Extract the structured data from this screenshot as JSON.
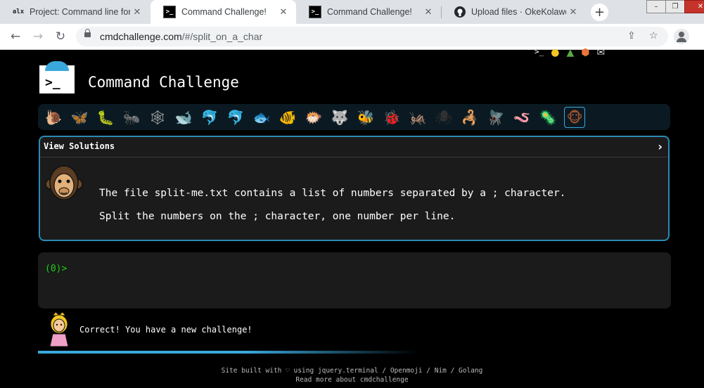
{
  "browser": {
    "tabs": [
      {
        "favicon": "alx",
        "title": "Project: Command line for",
        "active": false
      },
      {
        "favicon": "terminal-icon",
        "title": "Command Challenge!",
        "active": true
      },
      {
        "favicon": "terminal-icon",
        "title": "Command Challenge!",
        "active": false
      },
      {
        "favicon": "github-icon",
        "title": "Upload files · OkeKolawole",
        "active": false
      }
    ],
    "new_tab_label": "+",
    "url_host": "cmdchallenge.com",
    "url_path": "/#/split_on_a_char"
  },
  "page": {
    "title": "Command Challenge",
    "logo_glyph": ">_",
    "animals": [
      "snail",
      "butterfly",
      "caterpillar",
      "ant",
      "spider-web",
      "whale",
      "dolphin",
      "dolphin-gray",
      "fish",
      "tropical-fish",
      "blowfish",
      "wolf",
      "bee",
      "ladybug",
      "cricket",
      "spider",
      "scorpion",
      "fly",
      "worm",
      "microbe",
      "monkey"
    ],
    "panel": {
      "header": "View Solutions",
      "line1": "The file split-me.txt contains a list of numbers separated by a ; character.",
      "line2": "Split the numbers on the ; character, one number per line."
    },
    "terminal": {
      "prompt": "(0)>"
    },
    "status": {
      "message": "Correct! You have a new challenge!"
    },
    "footer": {
      "line1": "Site built with ♡ using jquery.terminal / Openmoji / Nim / Golang",
      "line2": "Read more about cmdchallenge"
    }
  },
  "colors": {
    "accent": "#2a8bb3",
    "prompt": "#1ad31a",
    "background": "#000000",
    "panel": "#1b1b1b"
  }
}
